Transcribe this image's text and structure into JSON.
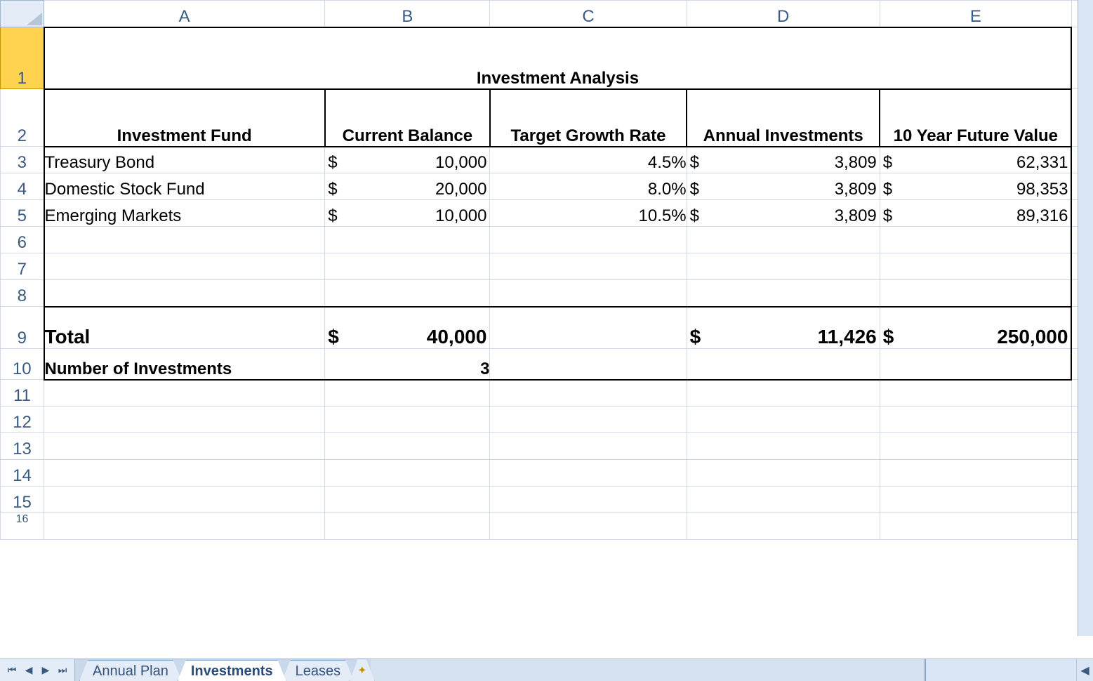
{
  "columns": [
    "A",
    "B",
    "C",
    "D",
    "E"
  ],
  "row_labels": [
    "1",
    "2",
    "3",
    "4",
    "5",
    "6",
    "7",
    "8",
    "9",
    "10",
    "11",
    "12",
    "13",
    "14",
    "15",
    "16"
  ],
  "title": "Investment Analysis",
  "headers": {
    "a": "Investment Fund",
    "b": "Current Balance",
    "c": "Target Growth Rate",
    "d": "Annual Investments",
    "e": "10 Year Future Value"
  },
  "currency_symbol": "$",
  "rows": [
    {
      "fund": "Treasury Bond",
      "balance": "10,000",
      "rate": "4.5%",
      "annual": "3,809",
      "future": "62,331"
    },
    {
      "fund": "Domestic Stock Fund",
      "balance": "20,000",
      "rate": "8.0%",
      "annual": "3,809",
      "future": "98,353"
    },
    {
      "fund": "Emerging Markets",
      "balance": "10,000",
      "rate": "10.5%",
      "annual": "3,809",
      "future": "89,316"
    }
  ],
  "total": {
    "label": "Total",
    "balance": "40,000",
    "annual": "11,426",
    "future": "250,000"
  },
  "num_investments": {
    "label": "Number of Investments",
    "value": "3"
  },
  "tabs": {
    "items": [
      "Annual Plan",
      "Investments",
      "Leases"
    ],
    "active": "Investments"
  },
  "chart_data": {
    "type": "table",
    "title": "Investment Analysis",
    "columns": [
      "Investment Fund",
      "Current Balance",
      "Target Growth Rate",
      "Annual Investments",
      "10 Year Future Value"
    ],
    "rows": [
      [
        "Treasury Bond",
        10000,
        0.045,
        3809,
        62331
      ],
      [
        "Domestic Stock Fund",
        20000,
        0.08,
        3809,
        98353
      ],
      [
        "Emerging Markets",
        10000,
        0.105,
        3809,
        89316
      ]
    ],
    "totals": {
      "Current Balance": 40000,
      "Annual Investments": 11426,
      "10 Year Future Value": 250000
    },
    "count": 3
  }
}
